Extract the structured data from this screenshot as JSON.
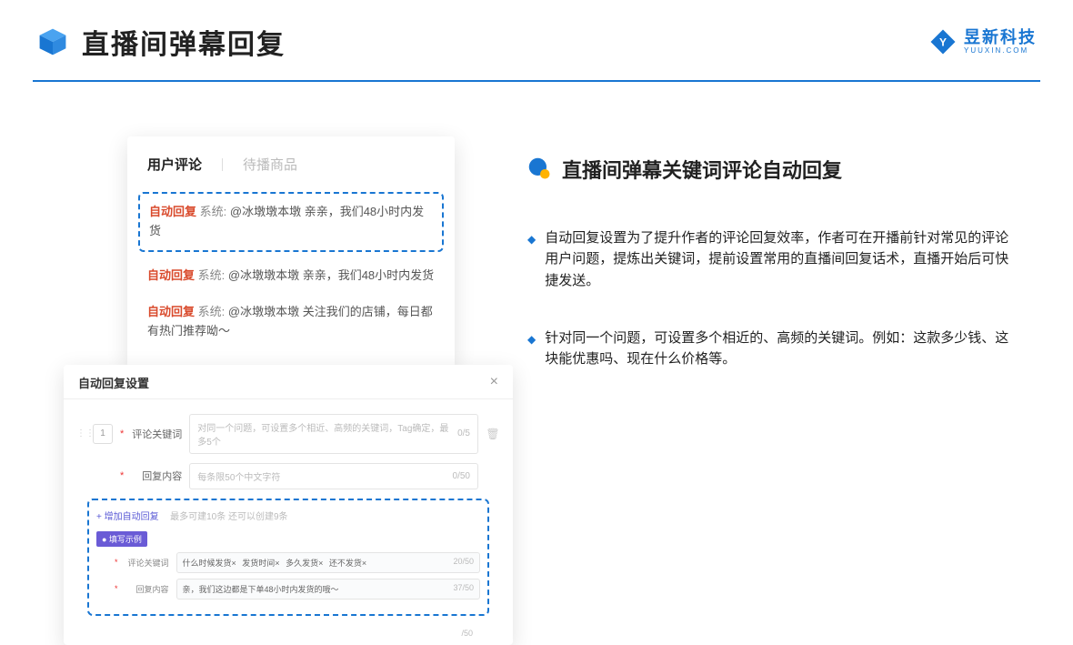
{
  "header": {
    "title": "直播间弹幕回复",
    "brand_cn": "昱新科技",
    "brand_en": "YUUXIN.COM"
  },
  "comments": {
    "tab_active": "用户评论",
    "tab_inactive": "待播商品",
    "items": [
      {
        "tag": "自动回复",
        "sys": "系统:",
        "text": "@冰墩墩本墩 亲亲，我们48小时内发货"
      },
      {
        "tag": "自动回复",
        "sys": "系统:",
        "text": "@冰墩墩本墩 亲亲，我们48小时内发货"
      },
      {
        "tag": "自动回复",
        "sys": "系统:",
        "text": "@冰墩墩本墩 关注我们的店铺，每日都有热门推荐呦～"
      }
    ]
  },
  "settings": {
    "title": "自动回复设置",
    "num": "1",
    "keyword_label": "评论关键词",
    "keyword_placeholder": "对同一个问题，可设置多个相近、高频的关键词，Tag确定，最多5个",
    "keyword_count": "0/5",
    "content_label": "回复内容",
    "content_placeholder": "每条限50个中文字符",
    "content_count": "0/50",
    "add_link": "+ 增加自动回复",
    "add_note": "最多可建10条 还可以创建9条",
    "example_badge": "● 填写示例",
    "ex_keyword_label": "评论关键词",
    "ex_keywords": [
      "什么时候发货×",
      "发货时间×",
      "多久发货×",
      "还不发货×"
    ],
    "ex_keyword_count": "20/50",
    "ex_content_label": "回复内容",
    "ex_content_text": "亲，我们这边都是下单48小时内发货的哦～",
    "ex_content_count": "37/50",
    "bottom_count": "/50"
  },
  "right": {
    "title": "直播间弹幕关键词评论自动回复",
    "bullets": [
      "自动回复设置为了提升作者的评论回复效率，作者可在开播前针对常见的评论用户问题，提炼出关键词，提前设置常用的直播间回复话术，直播开始后可快捷发送。",
      "针对同一个问题，可设置多个相近的、高频的关键词。例如：这款多少钱、这块能优惠吗、现在什么价格等。"
    ]
  }
}
